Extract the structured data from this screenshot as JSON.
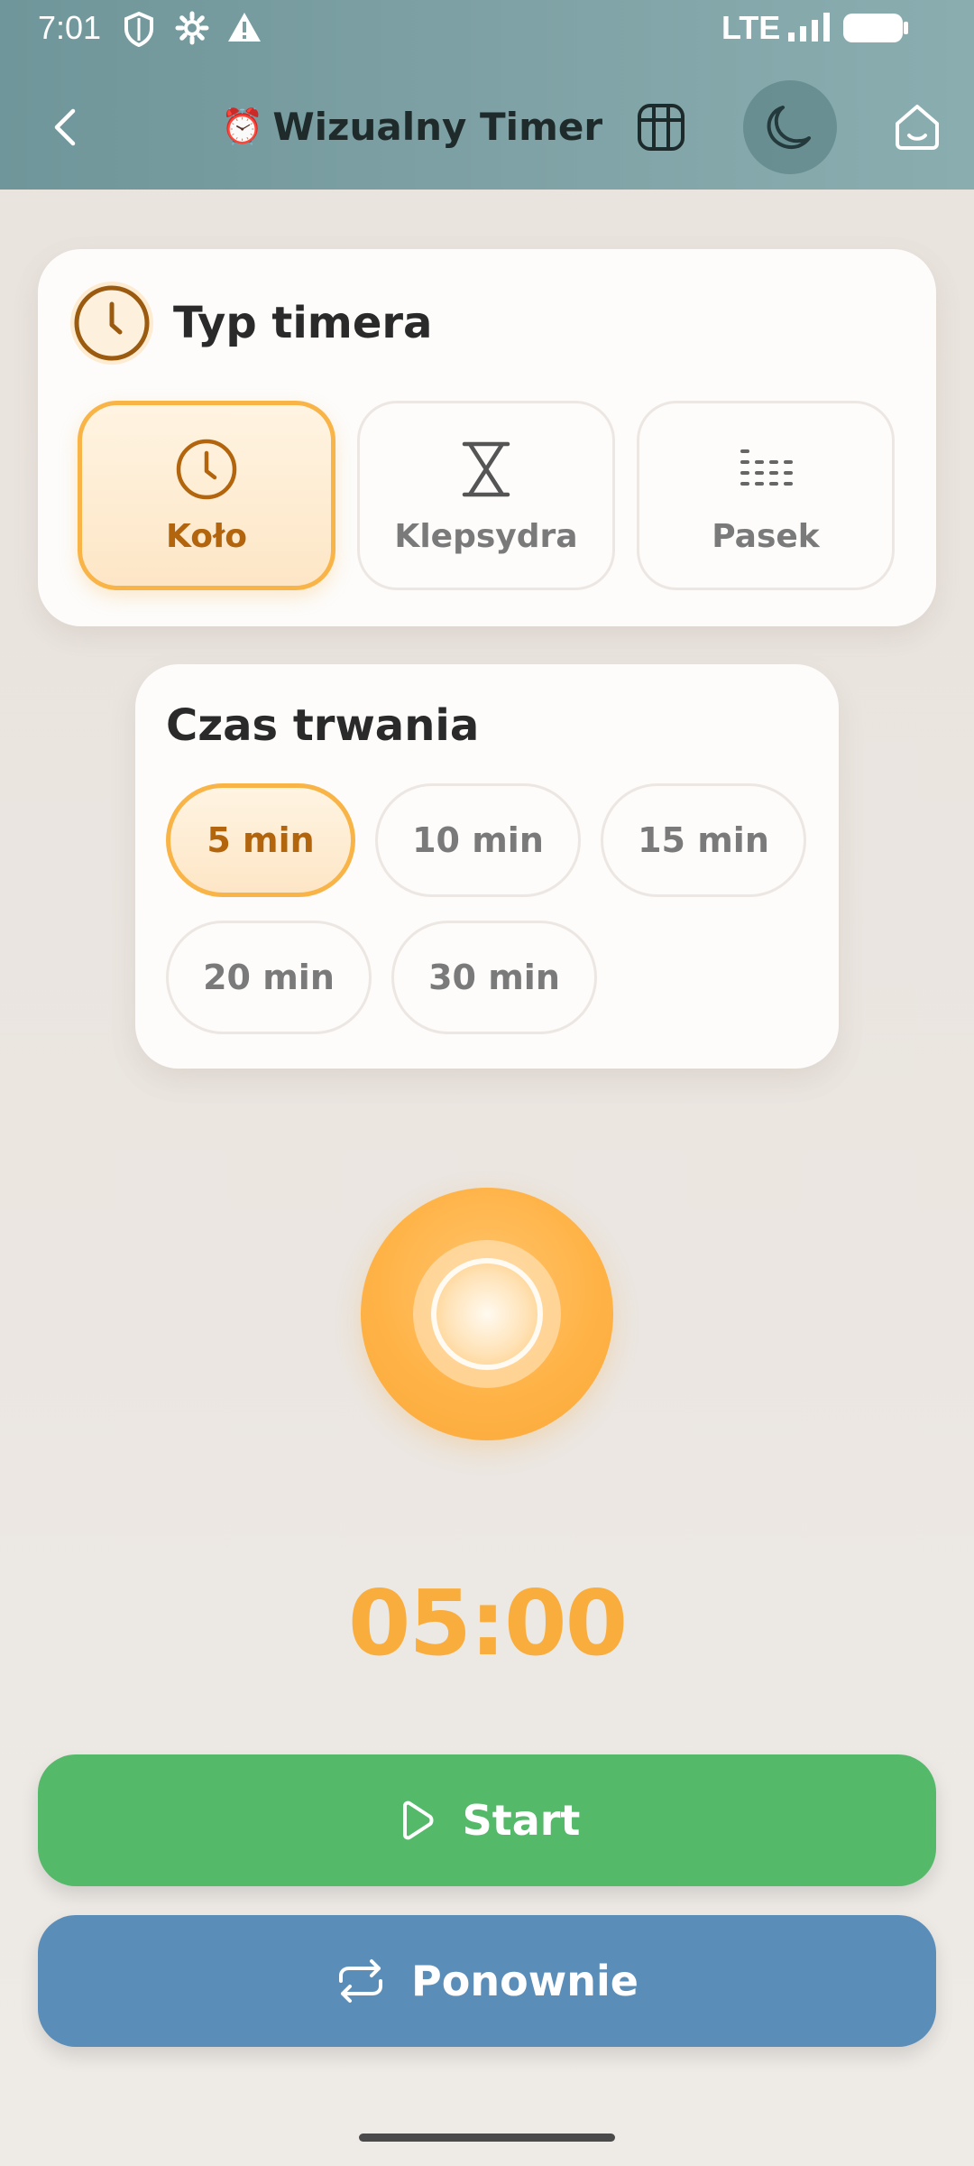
{
  "status_bar": {
    "time": "7:01",
    "network": "LTE",
    "icons": [
      "shield-icon",
      "gear-icon",
      "warning-icon",
      "signal-icon",
      "battery-icon"
    ]
  },
  "header": {
    "emoji": "⏰",
    "title": "Wizualny Timer",
    "icons": [
      "back-icon",
      "grid-icon",
      "moon-icon",
      "home-icon"
    ]
  },
  "timer_type": {
    "title": "Typ timera",
    "options": [
      {
        "label": "Koło",
        "icon": "clock-icon",
        "selected": true
      },
      {
        "label": "Klepsydra",
        "icon": "hourglass-icon",
        "selected": false
      },
      {
        "label": "Pasek",
        "icon": "bars-icon",
        "selected": false
      }
    ]
  },
  "duration": {
    "title": "Czas trwania",
    "options": [
      {
        "label": "5 min",
        "selected": true
      },
      {
        "label": "10 min",
        "selected": false
      },
      {
        "label": "15 min",
        "selected": false
      },
      {
        "label": "20 min",
        "selected": false
      },
      {
        "label": "30 min",
        "selected": false
      }
    ]
  },
  "display": {
    "time": "05:00"
  },
  "actions": {
    "start_label": "Start",
    "reset_label": "Ponownie"
  },
  "colors": {
    "accent": "#f9b447",
    "accent_text": "#b2650c",
    "start": "#55b96a",
    "reset": "#5b8db9",
    "header": "#7ea1a5"
  }
}
